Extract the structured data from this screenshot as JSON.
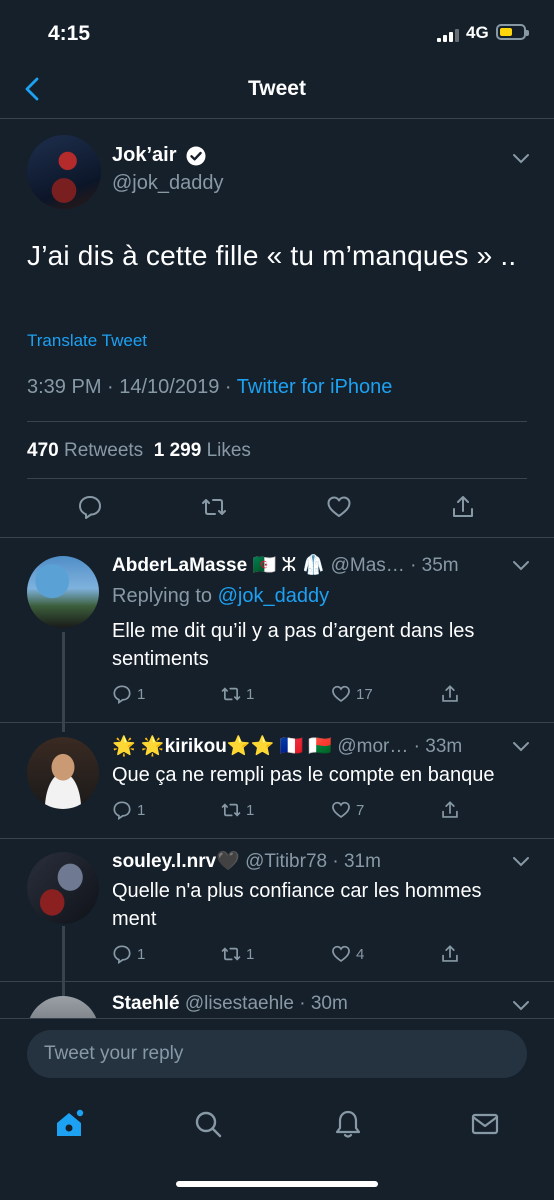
{
  "status": {
    "time": "4:15",
    "network": "4G",
    "battery_level": 0.55
  },
  "nav": {
    "title": "Tweet"
  },
  "tweet": {
    "author_name": "Jok’air",
    "handle": "@jok_daddy",
    "text": "J’ai dis à cette fille « tu m’manques » ..",
    "translate": "Translate Tweet",
    "time": "3:39 PM · 14/10/2019 · ",
    "source": "Twitter for iPhone",
    "retweets_count": "470",
    "retweets_label": "Retweets",
    "likes_count": "1 299",
    "likes_label": "Likes"
  },
  "replies": [
    {
      "name": "AbderLaMasse",
      "name_suffix": "🇩🇿 ⵣ 🥼",
      "handle": "@Mas…",
      "time": "· 35m",
      "replying_prefix": "Replying to ",
      "replying_handle": "@jok_daddy",
      "text": "Elle me dit qu’il y a pas d’argent dans les sentiments",
      "replies": "1",
      "retweets": "1",
      "likes": "17"
    },
    {
      "name_prefix": "🌟 🌟",
      "name": "kirikou",
      "name_suffix": "⭐⭐ 🇫🇷 🇲🇬",
      "handle": "@mor…",
      "time": "· 33m",
      "text": "Que ça ne rempli pas le compte en banque",
      "replies": "1",
      "retweets": "1",
      "likes": "7"
    },
    {
      "name": "souley.l.nrv",
      "name_suffix": "🖤",
      "handle": "@Titibr78",
      "time": "· 31m",
      "text": "Quelle n'a plus confiance car les hommes ment",
      "replies": "1",
      "retweets": "1",
      "likes": "4"
    },
    {
      "name": "Staehlé",
      "handle": "@lisestaehle",
      "time": "· 30m"
    }
  ],
  "composer": {
    "placeholder": "Tweet your reply"
  },
  "tabbar": {
    "items": [
      "home-icon",
      "search-icon",
      "notifications-icon",
      "messages-icon"
    ]
  },
  "colors": {
    "background": "#15202b",
    "accent": "#1da1f2",
    "muted": "#8899a6",
    "divider": "#38444d",
    "battery": "#ffd60a"
  }
}
